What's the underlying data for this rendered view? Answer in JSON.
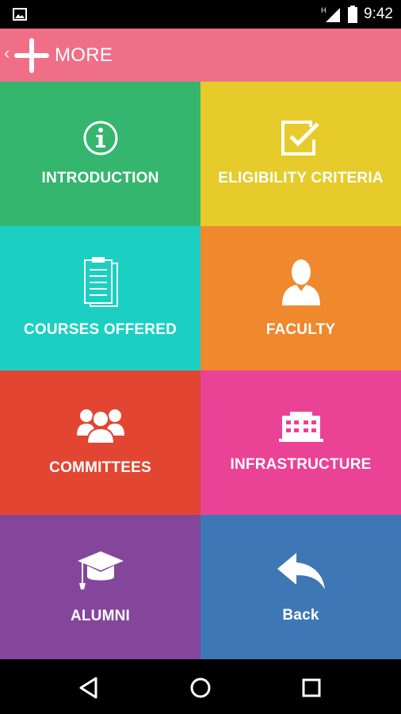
{
  "status_bar": {
    "time": "9:42",
    "network_label": "H"
  },
  "app_bar": {
    "back_glyph": "‹",
    "title": "MORE"
  },
  "tiles": [
    {
      "label": "INTRODUCTION",
      "icon": "info-icon",
      "color": "#35b66f"
    },
    {
      "label": "ELIGIBILITY CRITERIA",
      "icon": "checkbox-icon",
      "color": "#e6cb2b"
    },
    {
      "label": "COURSES OFFERED",
      "icon": "clipboard-icon",
      "color": "#1bd0c2"
    },
    {
      "label": "FACULTY",
      "icon": "person-icon",
      "color": "#f0882d"
    },
    {
      "label": "COMMITTEES",
      "icon": "group-icon",
      "color": "#e24633"
    },
    {
      "label": "INFRASTRUCTURE",
      "icon": "building-icon",
      "color": "#ea4295"
    },
    {
      "label": "ALUMNI",
      "icon": "graduation-cap-icon",
      "color": "#84469b"
    },
    {
      "label": "Back",
      "icon": "reply-arrow-icon",
      "color": "#3e77b5"
    }
  ],
  "colors": {
    "app_bar": "#ef6f89",
    "status_bar": "#000000",
    "nav_bar": "#000000"
  },
  "nav": {
    "back_icon": "triangle-back-icon",
    "home_icon": "circle-home-icon",
    "recents_icon": "square-recents-icon"
  }
}
